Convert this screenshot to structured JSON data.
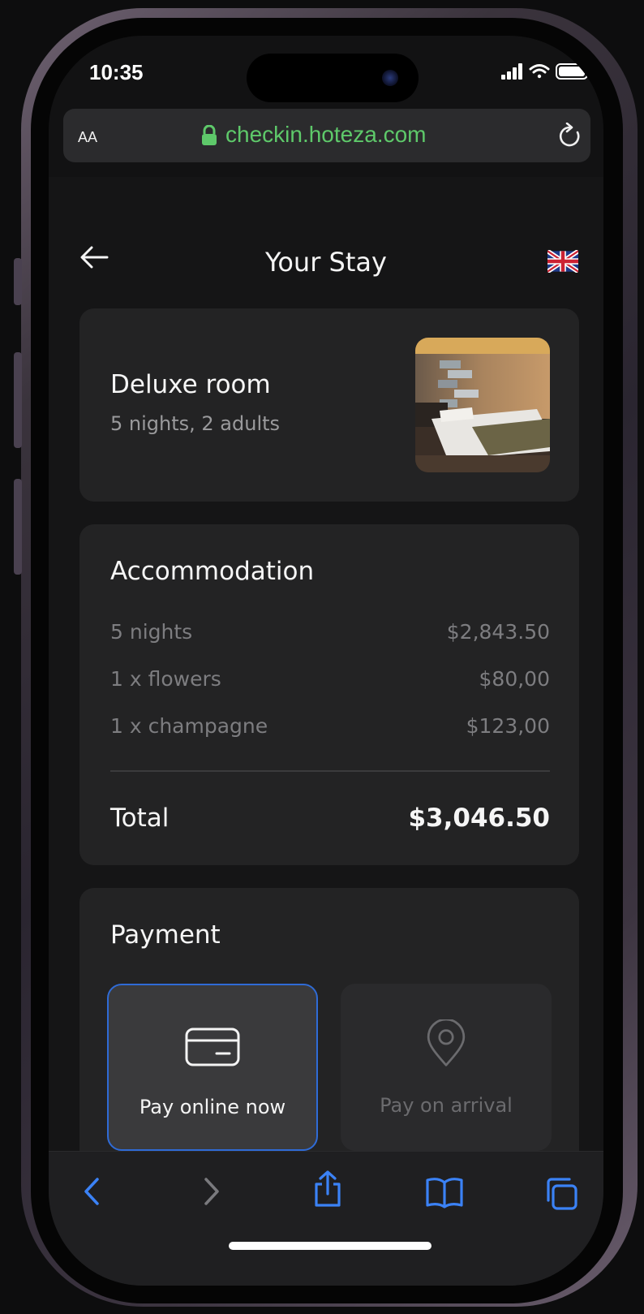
{
  "status_bar": {
    "time": "10:35"
  },
  "browser": {
    "text_size_label": "AA",
    "url": "checkin.hoteza.com"
  },
  "header": {
    "title": "Your Stay",
    "language_flag": "uk-flag-icon"
  },
  "room": {
    "name": "Deluxe room",
    "details": "5 nights, 2 adults"
  },
  "accommodation": {
    "heading": "Accommodation",
    "items": [
      {
        "label": "5 nights",
        "price": "$2,843.50"
      },
      {
        "label": "1 x flowers",
        "price": "$80,00"
      },
      {
        "label": "1 x champagne",
        "price": "$123,00"
      }
    ],
    "total_label": "Total",
    "total_amount": "$3,046.50"
  },
  "payment": {
    "heading": "Payment",
    "options": [
      {
        "label": "Pay online now",
        "icon": "credit-card-icon",
        "selected": true
      },
      {
        "label": "Pay on arrival",
        "icon": "location-pin-icon",
        "selected": false
      }
    ]
  },
  "toolbar": {
    "buttons": [
      "back-icon",
      "forward-icon",
      "share-icon",
      "bookmarks-icon",
      "tabs-icon"
    ]
  },
  "colors": {
    "accent": "#2f6bd6",
    "url_green": "#5ec96a",
    "card_bg": "#232324",
    "page_bg": "#151516"
  }
}
